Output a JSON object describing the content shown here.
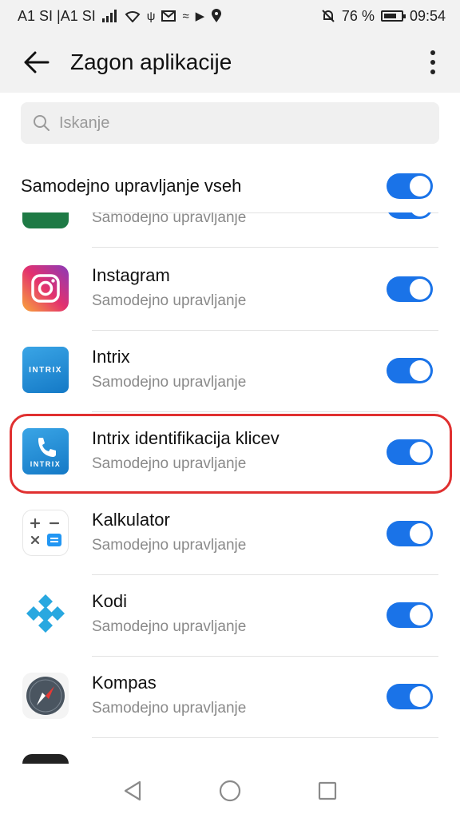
{
  "status_bar": {
    "carrier": "A1 SI |A1 SI",
    "battery_percent": "76 %",
    "time": "09:54",
    "battery_level": 0.76,
    "icons": [
      "signal-icon",
      "wifi-icon",
      "usb-icon",
      "mail-icon",
      "cast-icon",
      "play-icon",
      "location-icon",
      "mute-icon",
      "battery-icon"
    ]
  },
  "app_bar": {
    "title": "Zagon aplikacije"
  },
  "search": {
    "placeholder": "Iskanje"
  },
  "master_toggle": {
    "label": "Samodejno upravljanje vseh",
    "on": true
  },
  "apps": [
    {
      "name": "",
      "subtitle": "Samodejno upravljanje",
      "icon": "green-app-icon",
      "on": true
    },
    {
      "name": "Instagram",
      "subtitle": "Samodejno upravljanje",
      "icon": "instagram-icon",
      "on": true
    },
    {
      "name": "Intrix",
      "subtitle": "Samodejno upravljanje",
      "icon": "intrix-icon",
      "icon_text": "INTRIX",
      "on": true
    },
    {
      "name": "Intrix identifikacija klicev",
      "subtitle": "Samodejno upravljanje",
      "icon": "intrix-caller-id-icon",
      "icon_text": "INTRIX",
      "on": true,
      "highlighted": true
    },
    {
      "name": "Kalkulator",
      "subtitle": "Samodejno upravljanje",
      "icon": "calculator-icon",
      "on": true
    },
    {
      "name": "Kodi",
      "subtitle": "Samodejno upravljanje",
      "icon": "kodi-icon",
      "on": true
    },
    {
      "name": "Kompas",
      "subtitle": "Samodejno upravljanje",
      "icon": "compass-icon",
      "on": true
    }
  ],
  "colors": {
    "accent": "#1a73e8",
    "highlight": "#e03030",
    "background": "#ffffff",
    "bar": "#f2f2f2"
  },
  "nav_bar": {
    "icons": [
      "back-triangle-icon",
      "home-circle-icon",
      "recents-square-icon"
    ]
  }
}
